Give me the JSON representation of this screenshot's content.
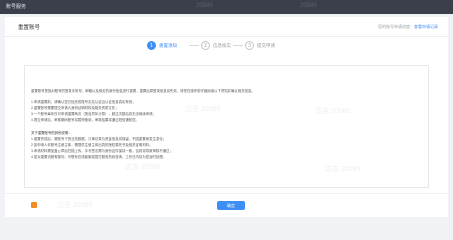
{
  "topbar": {
    "title": "账号服务",
    "watermarks": [
      "20585",
      "20585"
    ]
  },
  "header": {
    "title": "重置账号",
    "subtitle_prefix": "您的账号申请进度：",
    "subtitle_link": "查看申请记录"
  },
  "steps": [
    {
      "number": "1",
      "label": "重置须知"
    },
    {
      "number": "2",
      "label": "信息核实"
    },
    {
      "number": "3",
      "label": "提交申请"
    }
  ],
  "notice": {
    "lines": [
      "重置账号是指对账号的登录手机号、邮箱以及绑定的身份信息进行重置，重置后原登录信息将失效，请您在操作前仔细阅读以下须知并确认相关信息。",
      "1.申请重置前，请确认您已经完成账号实名认证且认证信息真实有效；",
      "2.重置账号需要提交申请人身份证明材料及相关资质文件；",
      "3.一个账号每年仅可申请重置两次（按自然年计算），超过次数后将无法继续申请；",
      "4.提交申请后，审核期间账号将暂停使用，审核结果将通过短信通知您。",
      "关于重置账号的其他说明：",
      "1.重置完成后，原账号下的业务数据、订单记录与资金信息将保留，不因重置而发生变化；",
      "2.如申请人非账号注册主体，需提供注册主体出具的授权委托书及相关证明材料；",
      "3.申请材料需加盖公章后扫描上传，手写签名需与身份证件保持一致，否则将导致审核不通过；",
      "4.如对重置流程有疑问，可联系在线客服或拨打服务热线咨询，工作日内将为您及时处理。"
    ]
  },
  "watermark_text": "边吉 20585",
  "footer": {
    "next_label": "确定"
  },
  "colors": {
    "accent": "#3e8ef7",
    "topbar": "#3a3f4b",
    "background": "#f0f2f5",
    "footer_icon": "#f08a24"
  },
  "icons": {
    "footer_icon": "app-logo-icon"
  }
}
